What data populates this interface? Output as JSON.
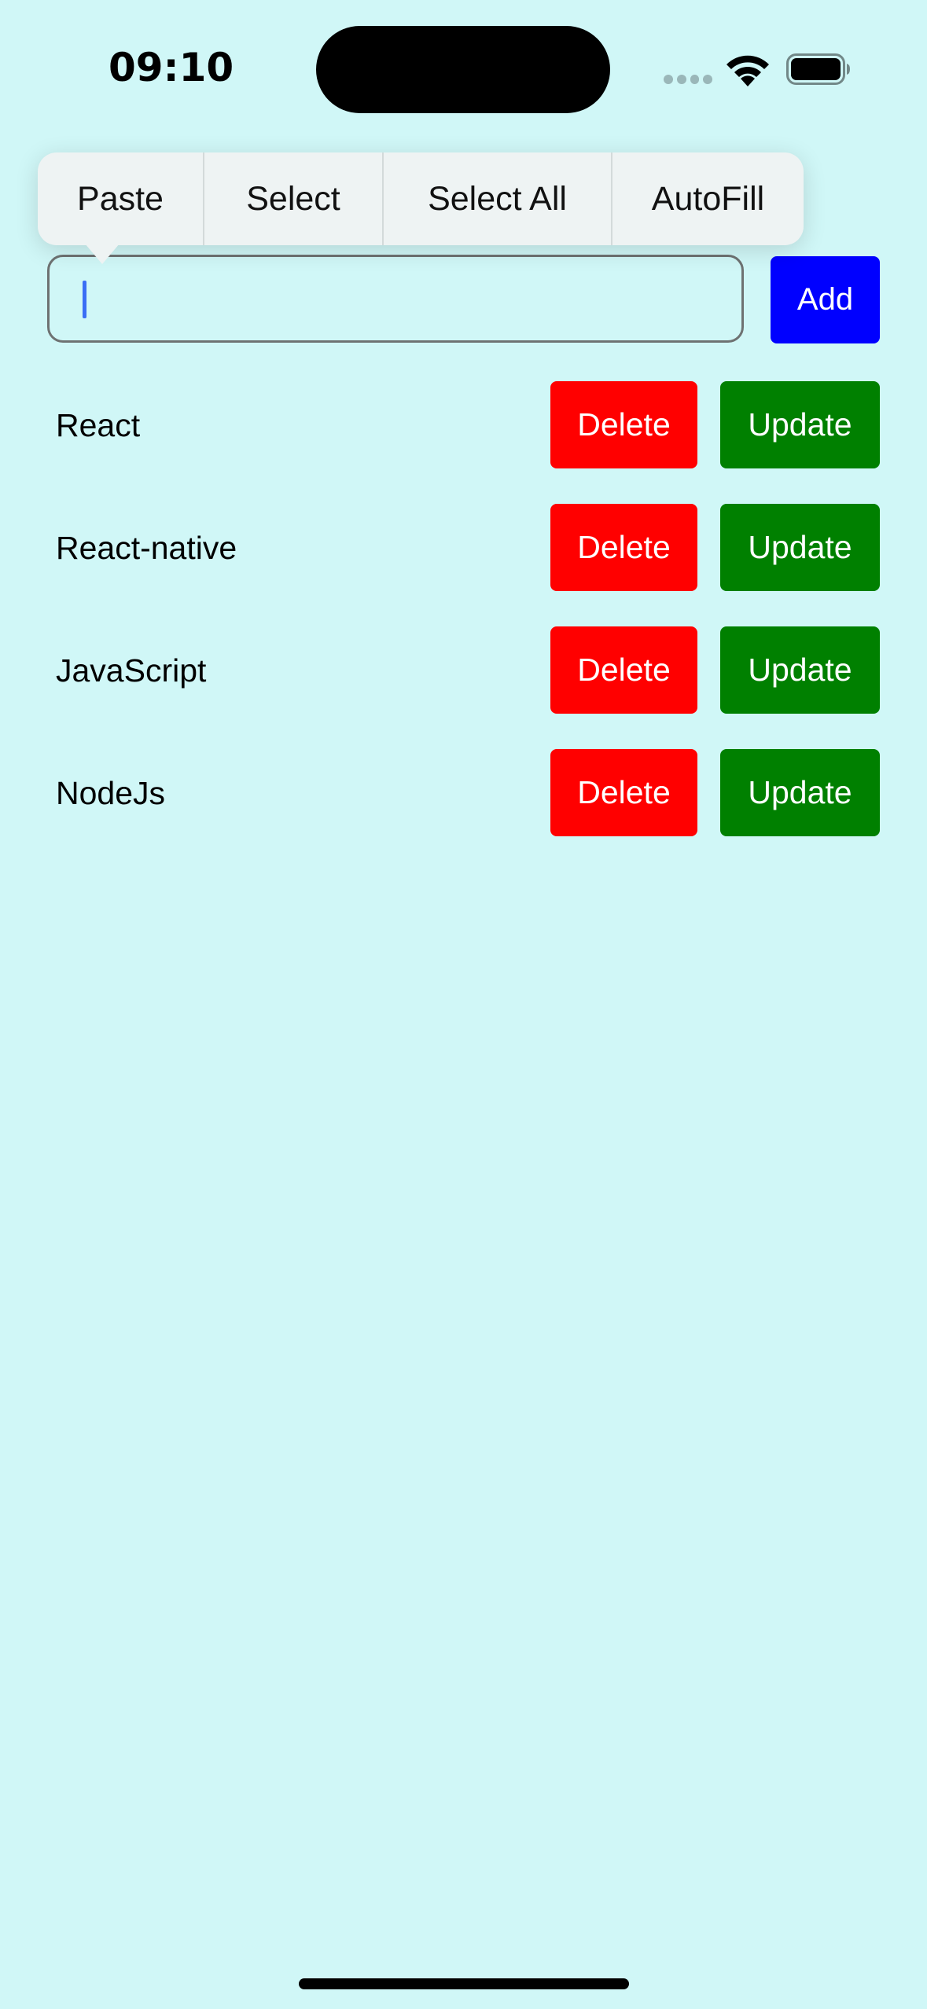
{
  "status_bar": {
    "time": "09:10"
  },
  "edit_menu": {
    "items": [
      "Paste",
      "Select",
      "Select All",
      "AutoFill"
    ]
  },
  "input": {
    "value": "",
    "placeholder": ""
  },
  "add_button_label": "Add",
  "list": [
    {
      "label": "React",
      "delete_label": "Delete",
      "update_label": "Update"
    },
    {
      "label": "React-native",
      "delete_label": "Delete",
      "update_label": "Update"
    },
    {
      "label": "JavaScript",
      "delete_label": "Delete",
      "update_label": "Update"
    },
    {
      "label": "NodeJs",
      "delete_label": "Delete",
      "update_label": "Update"
    }
  ],
  "colors": {
    "background": "#d0f7f7",
    "add_button": "#0000ff",
    "delete_button": "#ff0000",
    "update_button": "#008000",
    "caret": "#3b6ef5"
  },
  "icons": {
    "signal": "signal-dots-icon",
    "wifi": "wifi-icon",
    "battery": "battery-icon"
  }
}
